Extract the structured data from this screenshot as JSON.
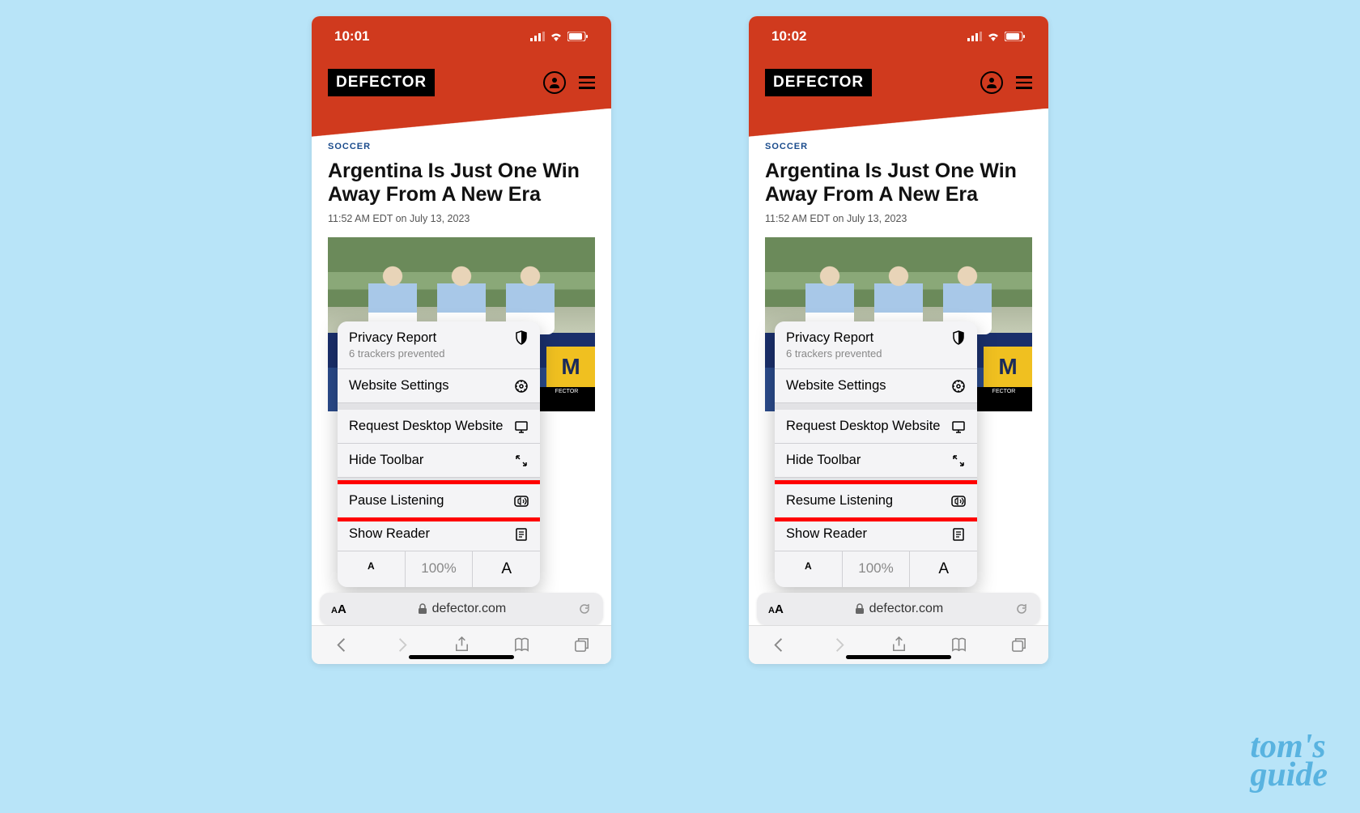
{
  "watermark": {
    "line1": "tom's",
    "line2": "guide"
  },
  "screens": [
    {
      "status": {
        "time": "10:01"
      },
      "site": {
        "logo": "DEFECTOR"
      },
      "article": {
        "category": "SOCCER",
        "headline": "Argentina Is Just One Win Away From A New Era",
        "timestamp": "11:52 AM EDT on July 13, 2023"
      },
      "menu": {
        "privacy": {
          "title": "Privacy Report",
          "sub": "6 trackers prevented"
        },
        "settings": "Website Settings",
        "desktop": "Request Desktop Website",
        "hideToolbar": "Hide Toolbar",
        "listen": "Pause Listening",
        "reader": "Show Reader",
        "zoom": {
          "dec": "A",
          "pct": "100%",
          "inc": "A"
        }
      },
      "address": {
        "aa": "AA",
        "domain": "defector.com"
      }
    },
    {
      "status": {
        "time": "10:02"
      },
      "site": {
        "logo": "DEFECTOR"
      },
      "article": {
        "category": "SOCCER",
        "headline": "Argentina Is Just One Win Away From A New Era",
        "timestamp": "11:52 AM EDT on July 13, 2023"
      },
      "menu": {
        "privacy": {
          "title": "Privacy Report",
          "sub": "6 trackers prevented"
        },
        "settings": "Website Settings",
        "desktop": "Request Desktop Website",
        "hideToolbar": "Hide Toolbar",
        "listen": "Resume Listening",
        "reader": "Show Reader",
        "zoom": {
          "dec": "A",
          "pct": "100%",
          "inc": "A"
        }
      },
      "address": {
        "aa": "AA",
        "domain": "defector.com"
      }
    }
  ]
}
